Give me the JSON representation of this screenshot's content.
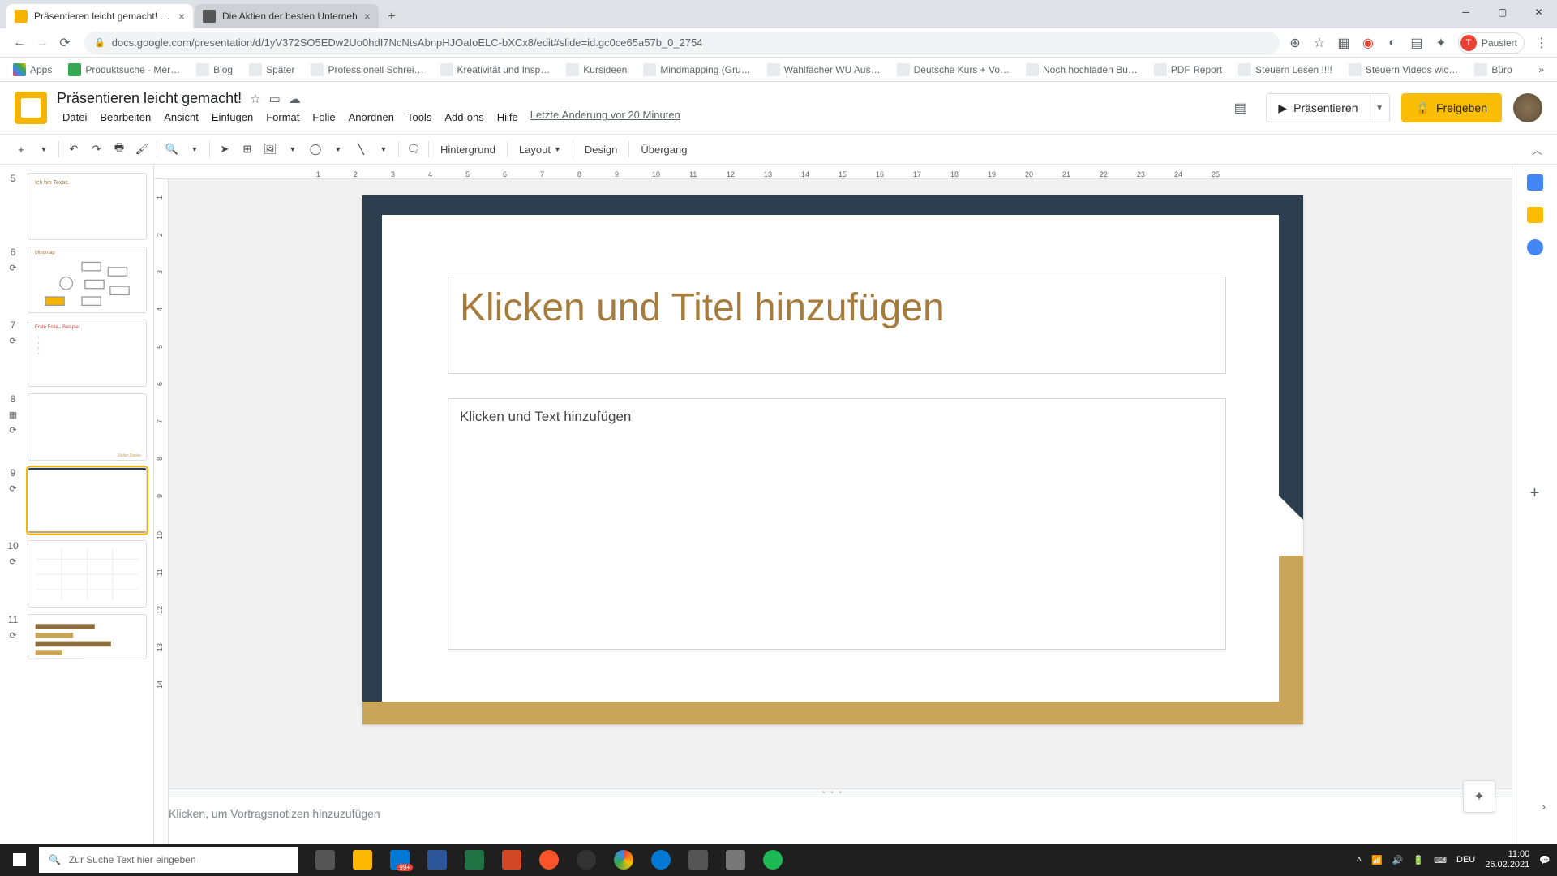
{
  "browser": {
    "tabs": [
      {
        "title": "Präsentieren leicht gemacht! - G",
        "active": true
      },
      {
        "title": "Die Aktien der besten Unterneh",
        "active": false
      }
    ],
    "url": "docs.google.com/presentation/d/1yV372SO5EDw2Uo0hdI7NcNtsAbnpHJOaIoELC-bXCx8/edit#slide=id.gc0ce65a57b_0_2754",
    "profile_label": "Pausiert",
    "profile_initial": "T",
    "bookmarks": [
      "Apps",
      "Produktsuche - Mer…",
      "Blog",
      "Später",
      "Professionell Schrei…",
      "Kreativität und Insp…",
      "Kursideen",
      "Mindmapping  (Gru…",
      "Wahlfächer WU Aus…",
      "Deutsche Kurs + Vo…",
      "Noch hochladen Bu…",
      "PDF Report",
      "Steuern Lesen !!!!",
      "Steuern Videos wic…",
      "Büro"
    ]
  },
  "app": {
    "doc_title": "Präsentieren leicht gemacht!",
    "menus": [
      "Datei",
      "Bearbeiten",
      "Ansicht",
      "Einfügen",
      "Format",
      "Folie",
      "Anordnen",
      "Tools",
      "Add-ons",
      "Hilfe"
    ],
    "last_edit": "Letzte Änderung vor 20 Minuten",
    "present": "Präsentieren",
    "share": "Freigeben"
  },
  "toolbar": {
    "background": "Hintergrund",
    "layout": "Layout",
    "design": "Design",
    "transition": "Übergang"
  },
  "ruler_h": [
    "1",
    "2",
    "3",
    "4",
    "5",
    "6",
    "7",
    "8",
    "9",
    "10",
    "11",
    "12",
    "13",
    "14",
    "15",
    "16",
    "17",
    "18",
    "19",
    "20",
    "21",
    "22",
    "23",
    "24",
    "25"
  ],
  "ruler_v": [
    "1",
    "2",
    "3",
    "4",
    "5",
    "6",
    "7",
    "8",
    "9",
    "10",
    "11",
    "12",
    "13",
    "14"
  ],
  "slides": {
    "visible_numbers": [
      "5",
      "6",
      "7",
      "8",
      "9",
      "10",
      "11"
    ],
    "selected_index": 4,
    "thumb5_title": "Ich bin Texas.",
    "thumb6_title": "Mindmap",
    "thumb7_title": "Erste Folie - Beispiel"
  },
  "slide": {
    "title_placeholder": "Klicken und Titel hinzufügen",
    "body_placeholder": "Klicken und Text hinzufügen"
  },
  "speaker_notes": "Klicken, um Vortragsnotizen hinzuzufügen",
  "taskbar": {
    "search_placeholder": "Zur Suche Text hier eingeben",
    "badge": "99+",
    "lang": "DEU",
    "time": "11:00",
    "date": "26.02.2021"
  }
}
